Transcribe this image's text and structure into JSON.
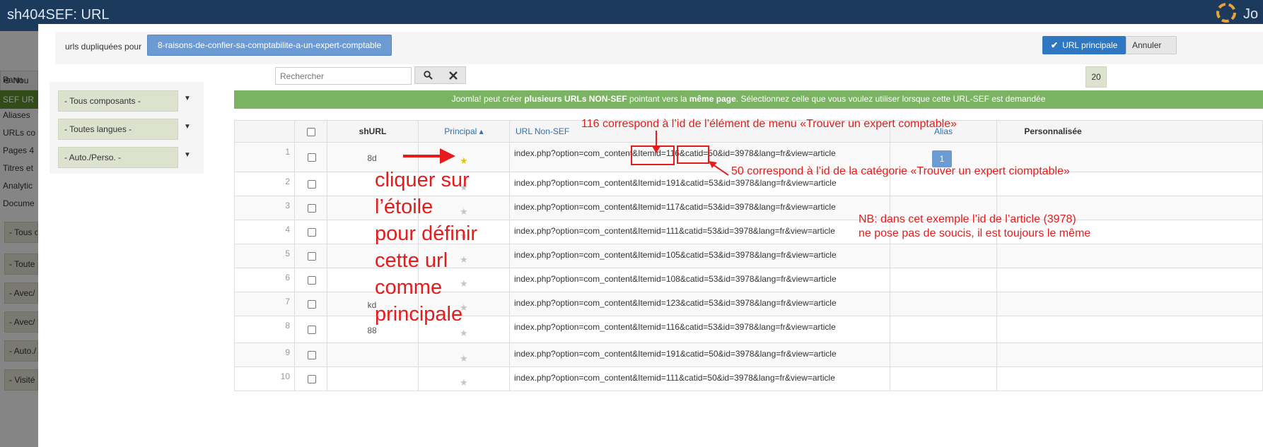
{
  "bg": {
    "title": "sh404SEF: URL",
    "new_button": "Nou",
    "sidebar": [
      "Pann",
      "SEF UR",
      "Aliases",
      "URLs co",
      "Pages 4",
      "Titres et",
      "Analytic",
      "Docume"
    ],
    "filters": [
      "- Tous c",
      "- Toute",
      "- Avec/",
      "- Avec/",
      "- Auto./",
      "- Visité"
    ]
  },
  "toolbar": {
    "dup_label": "urls dupliquées pour",
    "dup_chip": "8-raisons-de-confier-sa-comptabilite-a-un-expert-comptable",
    "primary_button": "URL principale",
    "cancel_button": "Annuler"
  },
  "filters": {
    "components": "- Tous composants -",
    "languages": "- Toutes langues -",
    "auto": "- Auto./Perso. -"
  },
  "search": {
    "placeholder": "Rechercher",
    "page_size": "20"
  },
  "banner": {
    "pre": "Joomla! peut créer ",
    "b1": "plusieurs URLs NON-SEF",
    "mid": " pointant vers la ",
    "b2": "même page",
    "post": ". Sélectionnez celle que vous voulez utiliser lorsque cette URL-SEF est demandée"
  },
  "table": {
    "headers": {
      "shurl": "shURL",
      "principal": "Principal ▴",
      "nonsef": "URL Non-SEF",
      "alias": "Alias",
      "custom": "Personnalisée"
    },
    "rows": [
      {
        "n": "1",
        "shurl": "8d",
        "url": "index.php?option=com_content&Itemid=116&catid=50&id=3978&lang=fr&view=article",
        "primary": true,
        "alias": "1"
      },
      {
        "n": "2",
        "shurl": "",
        "url": "index.php?option=com_content&Itemid=191&catid=53&id=3978&lang=fr&view=article",
        "primary": false,
        "alias": ""
      },
      {
        "n": "3",
        "shurl": "",
        "url": "index.php?option=com_content&Itemid=117&catid=53&id=3978&lang=fr&view=article",
        "primary": false,
        "alias": ""
      },
      {
        "n": "4",
        "shurl": "",
        "url": "index.php?option=com_content&Itemid=111&catid=53&id=3978&lang=fr&view=article",
        "primary": false,
        "alias": ""
      },
      {
        "n": "5",
        "shurl": "",
        "url": "index.php?option=com_content&Itemid=105&catid=53&id=3978&lang=fr&view=article",
        "primary": false,
        "alias": ""
      },
      {
        "n": "6",
        "shurl": "",
        "url": "index.php?option=com_content&Itemid=108&catid=53&id=3978&lang=fr&view=article",
        "primary": false,
        "alias": ""
      },
      {
        "n": "7",
        "shurl": "kd",
        "url": "index.php?option=com_content&Itemid=123&catid=53&id=3978&lang=fr&view=article",
        "primary": false,
        "alias": ""
      },
      {
        "n": "8",
        "shurl": "88",
        "url": "index.php?option=com_content&Itemid=116&catid=53&id=3978&lang=fr&view=article",
        "primary": false,
        "alias": ""
      },
      {
        "n": "9",
        "shurl": "",
        "url": "index.php?option=com_content&Itemid=191&catid=50&id=3978&lang=fr&view=article",
        "primary": false,
        "alias": ""
      },
      {
        "n": "10",
        "shurl": "",
        "url": "index.php?option=com_content&Itemid=111&catid=50&id=3978&lang=fr&view=article",
        "primary": false,
        "alias": ""
      }
    ]
  },
  "annotations": {
    "itemid_note": "116 correspond à l’id de l’élément de menu «Trouver un expert comptable»",
    "catid_note": "50 correspond à l’id de la catégorie «Trouver un expert ciomptable»",
    "nb_line1": "NB: dans cet exemple l’id de l’article (3978)",
    "nb_line2": "ne pose pas de soucis, il est toujours le même",
    "click_lines": [
      "cliquer sur",
      "l’étoile",
      "pour définir",
      "cette url",
      "comme",
      "principale"
    ]
  },
  "colors": {
    "annotation": "#e41c1c",
    "banner": "#7ab463",
    "primary_button": "#2f77c0",
    "chip": "#6c9bd4",
    "header": "#1c3a5c"
  }
}
